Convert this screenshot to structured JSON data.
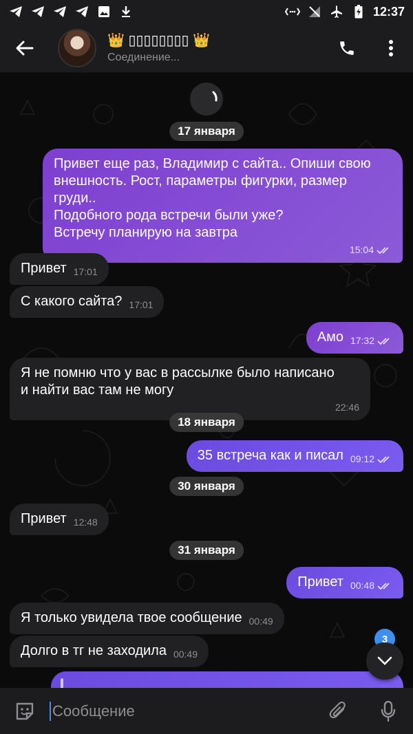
{
  "statusbar": {
    "time": "12:37"
  },
  "header": {
    "title": "👑 ▯▯▯▯▯▯▯▯ 👑",
    "status": "Соединение..."
  },
  "dates": {
    "d1": "17 января",
    "d2": "18 января",
    "d3": "30 января",
    "d4": "31 января"
  },
  "messages": [
    {
      "dir": "out",
      "text": "Привет еще раз, Владимир с сайта.. Опиши свою\nвнешность. Рост, параметры фигурки, размер\nгруди..\nПодобного рода встречи были уже?\nВстречу планирую на завтра",
      "time": "15:04"
    },
    {
      "dir": "in",
      "text": "Привет",
      "time": "17:01"
    },
    {
      "dir": "in",
      "text": "С какого сайта?",
      "time": "17:01"
    },
    {
      "dir": "out",
      "text": "Амо",
      "time": "17:32"
    },
    {
      "dir": "in",
      "text": "Я не помню что у вас в рассылке было написано\nи найти вас там не могу",
      "time": "22:46"
    },
    {
      "dir": "out",
      "text": "35 встреча как и писал",
      "time": "09:12"
    },
    {
      "dir": "in",
      "text": "Привет",
      "time": "12:48"
    },
    {
      "dir": "out",
      "text": "Привет",
      "time": "00:48"
    },
    {
      "dir": "in",
      "text": "Я только увидела твое сообщение",
      "time": "00:49"
    },
    {
      "dir": "in",
      "text": "Долго в тг не заходила",
      "time": "00:49"
    }
  ],
  "scroll_badge": "3",
  "input": {
    "placeholder": "Сообщение"
  },
  "colors": {
    "outgoing": "#7e3fd0",
    "outgoing_recent": "#6a4adf",
    "incoming": "#212124",
    "accent": "#3d8ff0"
  },
  "icons": {
    "statusbar_left": [
      "telegram-icon",
      "telegram-icon",
      "telegram-icon",
      "telegram-icon",
      "image-icon",
      "download-icon"
    ],
    "statusbar_right": [
      "data-arrows-icon",
      "no-signal-icon",
      "airplane-icon",
      "battery-icon"
    ]
  }
}
